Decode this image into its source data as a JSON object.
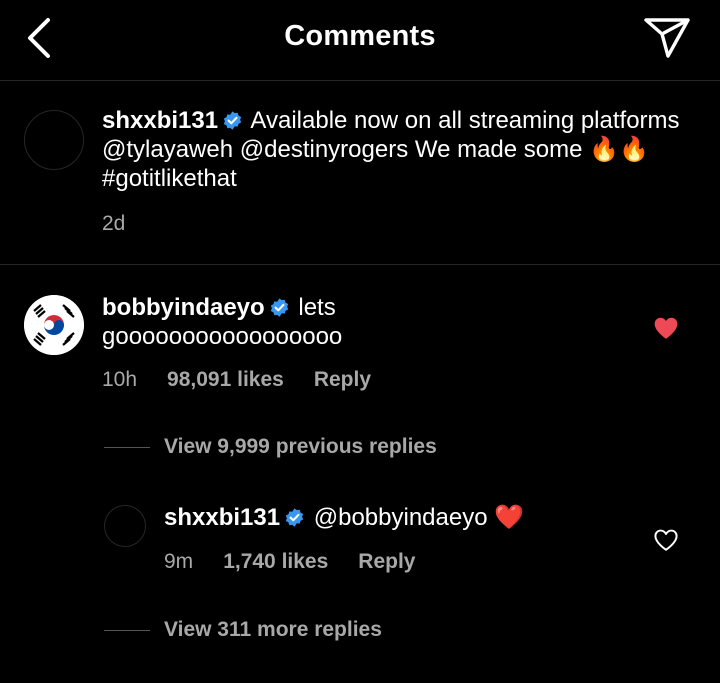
{
  "header": {
    "title": "Comments"
  },
  "caption": {
    "username": "shxxbi131",
    "text": "Available now on all streaming platforms @tylayaweh @destinyrogers We made some 🔥🔥 #gotitlikethat",
    "time": "2d"
  },
  "comments": [
    {
      "username": "bobbyindaeyo",
      "text": "lets gooooooooooooooooo",
      "time": "10h",
      "likes": "98,091 likes",
      "reply_label": "Reply",
      "liked": true,
      "avatar": "korean-flag"
    }
  ],
  "previous_replies_label": "View 9,999 previous replies",
  "reply": {
    "username": "shxxbi131",
    "text": "@bobbyindaeyo ❤️",
    "time": "9m",
    "likes": "1,740 likes",
    "reply_label": "Reply",
    "liked": false
  },
  "more_replies_label": "View 311 more replies",
  "colors": {
    "background": "#000000",
    "verified": "#3897f0",
    "liked_heart": "#ed4956",
    "secondary_text": "#a8a8a8"
  },
  "icons": {
    "back": "chevron-left-icon",
    "send": "paper-plane-icon",
    "verified": "verified-badge-icon",
    "like": "heart-icon"
  }
}
